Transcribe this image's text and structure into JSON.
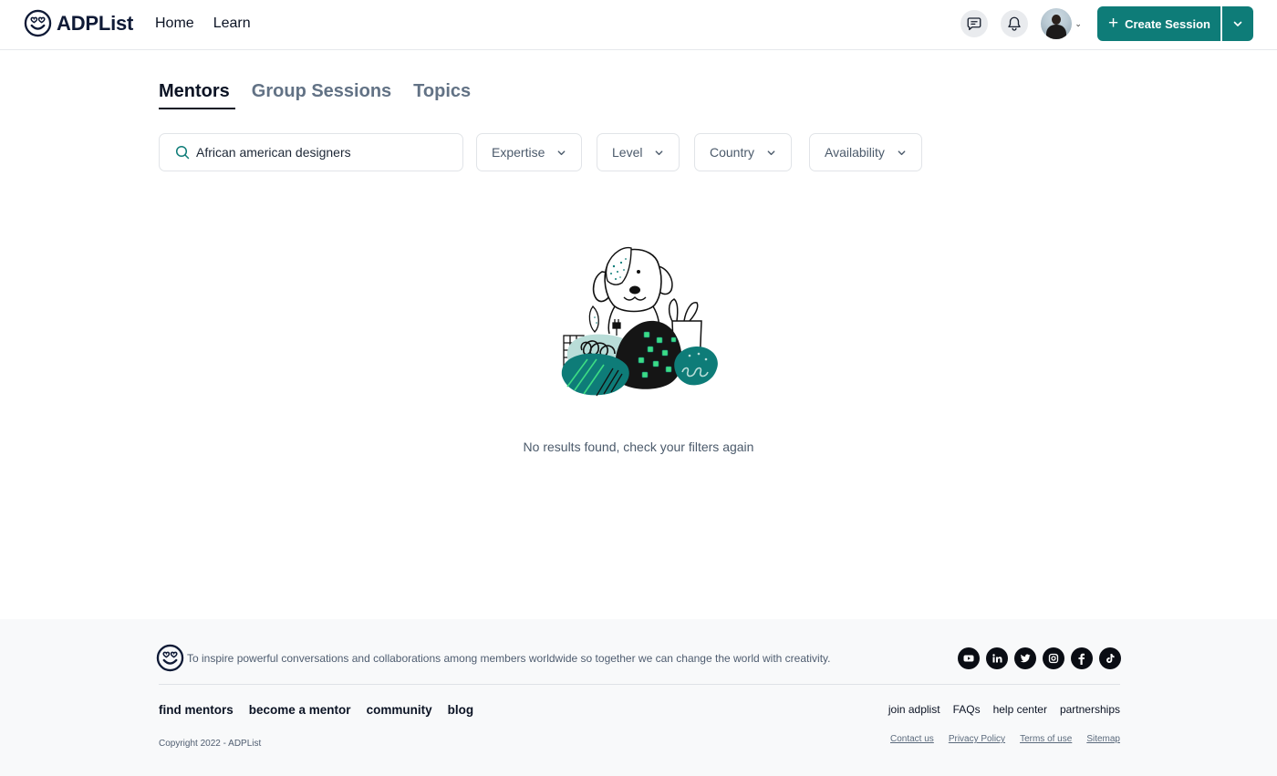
{
  "header": {
    "brand": "ADPList",
    "nav": [
      {
        "label": "Home"
      },
      {
        "label": "Learn"
      }
    ],
    "icons": {
      "messages": "chat-bubble-icon",
      "notifications": "bell-icon",
      "avatar": "user-avatar",
      "avatar_caret": "chevron-down-icon"
    },
    "create_session_label": "Create Session",
    "brand_color": "#0e7c78"
  },
  "tabs": [
    {
      "label": "Mentors",
      "active": true
    },
    {
      "label": "Group Sessions",
      "active": false
    },
    {
      "label": "Topics",
      "active": false
    }
  ],
  "filters": {
    "search_value": "African american designers",
    "dropdowns": [
      {
        "label": "Expertise"
      },
      {
        "label": "Level"
      },
      {
        "label": "Country"
      },
      {
        "label": "Availability"
      }
    ]
  },
  "empty_state": {
    "illustration": "dog-with-cushions-illustration",
    "message": "No results found, check your filters again"
  },
  "footer": {
    "mission": "To inspire powerful conversations and collaborations among members worldwide so together we can change the world with creativity.",
    "socials": [
      {
        "name": "youtube-icon"
      },
      {
        "name": "linkedin-icon"
      },
      {
        "name": "twitter-icon"
      },
      {
        "name": "instagram-icon"
      },
      {
        "name": "facebook-icon"
      },
      {
        "name": "tiktok-icon"
      }
    ],
    "links_left": [
      {
        "label": "find mentors"
      },
      {
        "label": "become a mentor"
      },
      {
        "label": "community"
      },
      {
        "label": "blog"
      }
    ],
    "links_right": [
      {
        "label": "join adplist"
      },
      {
        "label": "FAQs"
      },
      {
        "label": "help center"
      },
      {
        "label": "partnerships"
      }
    ],
    "copyright": "Copyright 2022 - ADPList",
    "legal": [
      {
        "label": "Contact us"
      },
      {
        "label": "Privacy Policy"
      },
      {
        "label": "Terms of use"
      },
      {
        "label": "Sitemap"
      }
    ]
  }
}
